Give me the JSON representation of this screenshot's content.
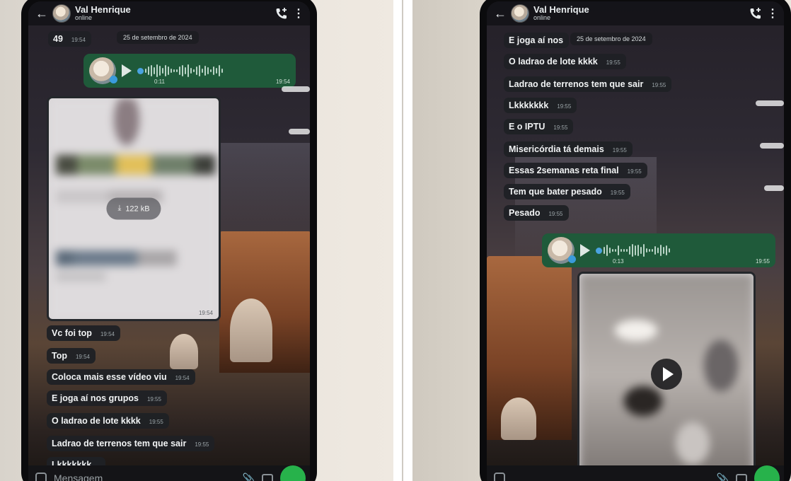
{
  "contact": {
    "name": "Val Henrique",
    "status": "online"
  },
  "date_chip": "25 de setembro de 2024",
  "left": {
    "partial_message": {
      "text": "49",
      "time": "19:54"
    },
    "voice_message": {
      "duration": "0:11",
      "time": "19:54"
    },
    "image_message": {
      "download_size": "122 kB",
      "time": "19:54"
    },
    "messages": [
      {
        "text": "Vc foi top",
        "time": "19:54"
      },
      {
        "text": "Top",
        "time": "19:54"
      },
      {
        "text": "Coloca mais esse vídeo viu",
        "time": "19:54"
      },
      {
        "text": "E joga aí nos grupos",
        "time": "19:55"
      },
      {
        "text": "O ladrao de lote kkkk",
        "time": "19:55"
      },
      {
        "text": "Ladrao de terrenos tem que sair",
        "time": "19:55"
      },
      {
        "text": "Lkkkkkkk",
        "time": ""
      }
    ],
    "composer_placeholder": "Mensagem"
  },
  "right": {
    "partial_message": {
      "text": "E joga aí nos",
      "time": ""
    },
    "messages": [
      {
        "text": "O ladrao de lote kkkk",
        "time": "19:55"
      },
      {
        "text": "Ladrao de terrenos tem que sair",
        "time": "19:55"
      },
      {
        "text": "Lkkkkkkk",
        "time": "19:55"
      },
      {
        "text": "E o IPTU",
        "time": "19:55"
      },
      {
        "text": "Misericórdia tá demais",
        "time": "19:55"
      },
      {
        "text": "Essas 2semanas reta final",
        "time": "19:55"
      },
      {
        "text": "Tem que bater pesado",
        "time": "19:55"
      },
      {
        "text": "Pesado",
        "time": "19:55"
      }
    ],
    "voice_message": {
      "duration": "0:13",
      "time": "19:55"
    }
  },
  "colors": {
    "bubble_incoming": "#1f2125",
    "bubble_outgoing": "#1f5a3a",
    "accent_green": "#27b24b"
  },
  "icons": [
    "back-arrow-icon",
    "call-add-icon",
    "more-vert-icon",
    "play-icon",
    "download-icon",
    "emoji-icon",
    "attach-icon",
    "camera-icon",
    "mic-icon"
  ]
}
